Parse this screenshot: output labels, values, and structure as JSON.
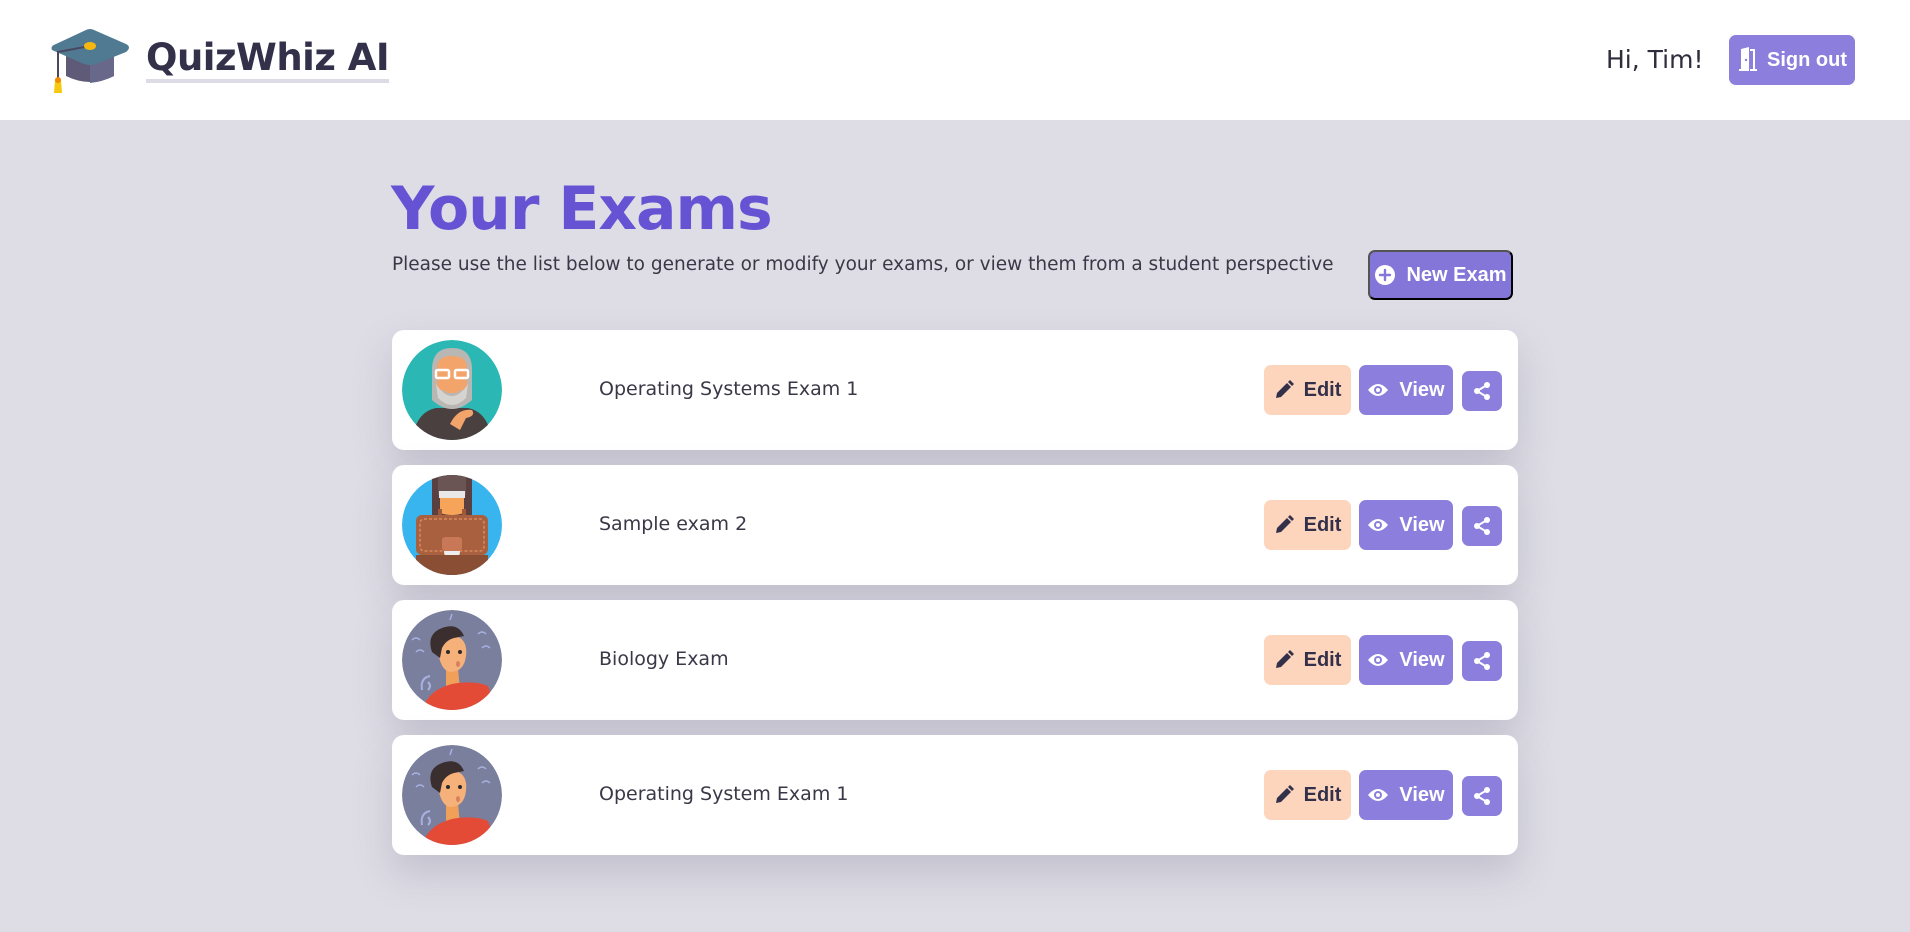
{
  "header": {
    "app_name": "QuizWhiz AI",
    "logo_icon": "graduation-cap-icon",
    "greeting": "Hi, Tim!",
    "signout_label": "Sign out",
    "signout_icon": "door-icon"
  },
  "main": {
    "title": "Your Exams",
    "subtitle": "Please use the list below to generate or modify your exams, or view them from a student perspective",
    "new_exam_label": "New Exam",
    "new_exam_icon": "plus-circle-icon"
  },
  "exams": [
    {
      "name": "Operating Systems Exam 1",
      "avatar": "old-man-thinking-avatar",
      "edit_label": "Edit",
      "view_label": "View"
    },
    {
      "name": "Sample exam 2",
      "avatar": "briefcase-avatar",
      "edit_label": "Edit",
      "view_label": "View"
    },
    {
      "name": "Biology Exam",
      "avatar": "confused-person-avatar",
      "edit_label": "Edit",
      "view_label": "View"
    },
    {
      "name": "Operating System Exam 1",
      "avatar": "confused-person-avatar",
      "edit_label": "Edit",
      "view_label": "View"
    }
  ],
  "colors": {
    "accent": "#6553d4",
    "button_purple": "#8b7edc",
    "edit_peach": "#fdd5bd",
    "background": "#dedde6"
  }
}
